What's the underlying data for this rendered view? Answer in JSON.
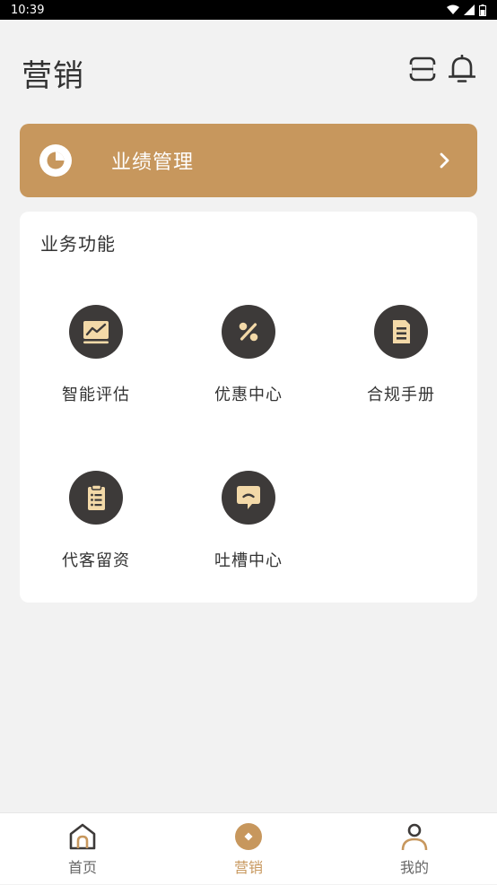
{
  "status_bar": {
    "time": "10:39"
  },
  "header": {
    "title": "营销",
    "icons": [
      "scan-icon",
      "bell-icon"
    ]
  },
  "performance": {
    "label": "业绩管理",
    "icon": "pie-chart-icon"
  },
  "functions": {
    "title": "业务功能",
    "items": [
      {
        "label": "智能评估",
        "icon": "chart-board-icon"
      },
      {
        "label": "优惠中心",
        "icon": "percent-icon"
      },
      {
        "label": "合规手册",
        "icon": "document-icon"
      },
      {
        "label": "代客留资",
        "icon": "clipboard-icon"
      },
      {
        "label": "吐槽中心",
        "icon": "chat-bubble-icon"
      }
    ]
  },
  "tabbar": {
    "items": [
      {
        "label": "首页",
        "icon": "home-icon",
        "active": false
      },
      {
        "label": "营销",
        "icon": "marketing-icon",
        "active": true
      },
      {
        "label": "我的",
        "icon": "user-icon",
        "active": false
      }
    ]
  },
  "colors": {
    "accent": "#c7975d",
    "icon_bg": "#3d3a39",
    "icon_fg": "#f3d9a8",
    "background": "#f2f2f2"
  }
}
